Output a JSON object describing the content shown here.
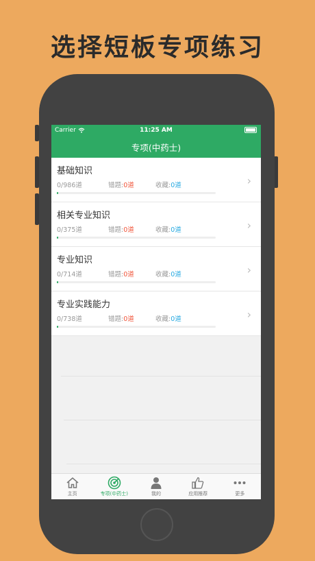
{
  "headline": "选择短板专项练习",
  "status": {
    "carrier": "Carrier",
    "time": "11:25 AM"
  },
  "nav": {
    "title": "专项(中药士)"
  },
  "labels": {
    "wrong": "错题:",
    "fav": "收藏:"
  },
  "items": [
    {
      "title": "基础知识",
      "progress": "0/986道",
      "wrong": "0道",
      "fav": "0道",
      "fraction": 0.0
    },
    {
      "title": "相关专业知识",
      "progress": "0/375道",
      "wrong": "0道",
      "fav": "0道",
      "fraction": 0.0
    },
    {
      "title": "专业知识",
      "progress": "0/714道",
      "wrong": "0道",
      "fav": "0道",
      "fraction": 0.0
    },
    {
      "title": "专业实践能力",
      "progress": "0/738道",
      "wrong": "0道",
      "fav": "0道",
      "fraction": 0.0
    }
  ],
  "tabs": [
    {
      "label": "主页",
      "icon": "home-icon"
    },
    {
      "label": "专项(中药士)",
      "icon": "target-icon",
      "active": true
    },
    {
      "label": "我的",
      "icon": "person-icon"
    },
    {
      "label": "应用推荐",
      "icon": "thumbs-up-icon"
    },
    {
      "label": "更多",
      "icon": "more-dots-icon"
    }
  ],
  "colors": {
    "background": "#EDA95E",
    "accent": "#2EAA64",
    "wrong": "#F0553A",
    "fav": "#26A9E0"
  }
}
